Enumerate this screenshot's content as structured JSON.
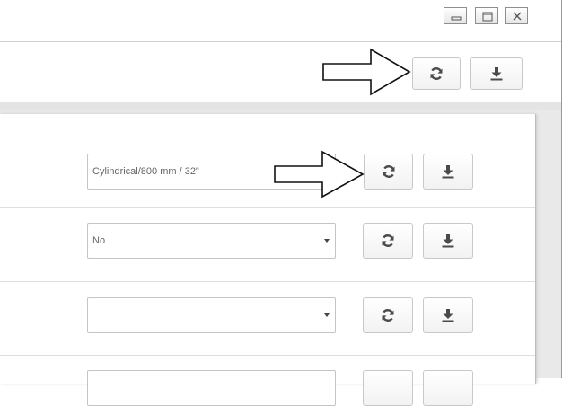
{
  "window": {
    "title": "",
    "controls": {
      "minimize": "minimize-icon",
      "maximize": "maximize-icon",
      "close": "close-icon"
    }
  },
  "toolbar": {
    "refresh_icon": "refresh-icon",
    "download_icon": "download-icon"
  },
  "rows": [
    {
      "value": "Cylindrical/800 mm / 32\"",
      "has_dropdown": false
    },
    {
      "value": "No",
      "has_dropdown": true
    },
    {
      "value": "",
      "has_dropdown": true
    },
    {
      "value": "",
      "has_dropdown": true
    }
  ],
  "colors": {
    "icon": "#4a4a4a",
    "button_border": "#c8c8c8",
    "arrow_stroke": "#111111"
  }
}
